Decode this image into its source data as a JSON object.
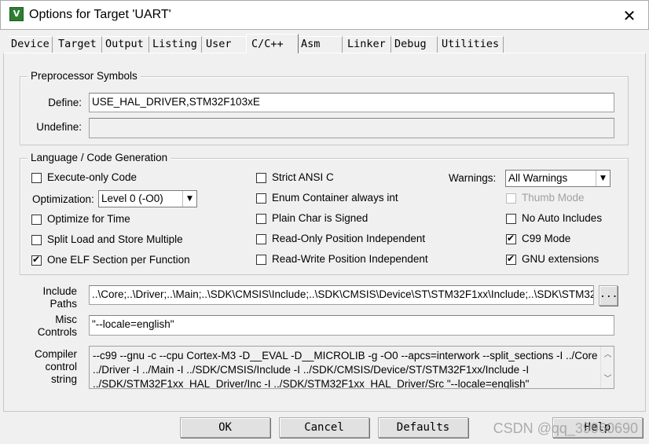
{
  "window": {
    "title": "Options for Target 'UART'",
    "app_icon": "keil-uv-icon",
    "app_icon_glyph": "V",
    "close_glyph": "✕"
  },
  "tabs": [
    "Device",
    "Target",
    "Output",
    "Listing",
    "User",
    "C/C++",
    "Asm",
    "Linker",
    "Debug",
    "Utilities"
  ],
  "active_tab": "C/C++",
  "preprocessor": {
    "legend": "Preprocessor Symbols",
    "define_label": "Define:",
    "define_value": "USE_HAL_DRIVER,STM32F103xE",
    "undefine_label": "Undefine:",
    "undefine_value": ""
  },
  "language": {
    "legend": "Language / Code Generation",
    "execute_only": {
      "label": "Execute-only Code",
      "checked": false
    },
    "optimization_label": "Optimization:",
    "optimization_value": "Level 0 (-O0)",
    "optimize_time": {
      "label": "Optimize for Time",
      "checked": false
    },
    "split_load_store": {
      "label": "Split Load and Store Multiple",
      "checked": false
    },
    "one_elf_section": {
      "label": "One ELF Section per Function",
      "checked": true
    },
    "strict_ansi": {
      "label": "Strict ANSI C",
      "checked": false
    },
    "enum_container": {
      "label": "Enum Container always int",
      "checked": false
    },
    "plain_char_signed": {
      "label": "Plain Char is Signed",
      "checked": false
    },
    "ro_pi": {
      "label": "Read-Only Position Independent",
      "checked": false
    },
    "rw_pi": {
      "label": "Read-Write Position Independent",
      "checked": false
    },
    "warnings_label": "Warnings:",
    "warnings_value": "All Warnings",
    "thumb_mode": {
      "label": "Thumb Mode",
      "checked": false,
      "disabled": true
    },
    "no_auto_includes": {
      "label": "No Auto Includes",
      "checked": false
    },
    "c99_mode": {
      "label": "C99 Mode",
      "checked": true
    },
    "gnu_extensions": {
      "label": "GNU extensions",
      "checked": true
    }
  },
  "include": {
    "label_line1": "Include",
    "label_line2": "Paths",
    "value": "..\\Core;..\\Driver;..\\Main;..\\SDK\\CMSIS\\Include;..\\SDK\\CMSIS\\Device\\ST\\STM32F1xx\\Include;..\\SDK\\STM32F1",
    "browse_label": "..."
  },
  "misc": {
    "label_line1": "Misc",
    "label_line2": "Controls",
    "value": "\"--locale=english\""
  },
  "compiler": {
    "label_line1": "Compiler",
    "label_line2": "control",
    "label_line3": "string",
    "text": "--c99 --gnu -c --cpu Cortex-M3 -D__EVAL -D__MICROLIB -g -O0 --apcs=interwork --split_sections -I ../Core -I\n../Driver -I ../Main -I ../SDK/CMSIS/Include -I ../SDK/CMSIS/Device/ST/STM32F1xx/Include -I\n../SDK/STM32F1xx_HAL_Driver/Inc -I ../SDK/STM32F1xx_HAL_Driver/Src \"--locale=english\"",
    "scroll_up": "︿",
    "scroll_down": "﹀"
  },
  "buttons": {
    "ok": "OK",
    "cancel": "Cancel",
    "defaults": "Defaults",
    "help": "Help"
  },
  "watermark": "CSDN @qq_39960690"
}
